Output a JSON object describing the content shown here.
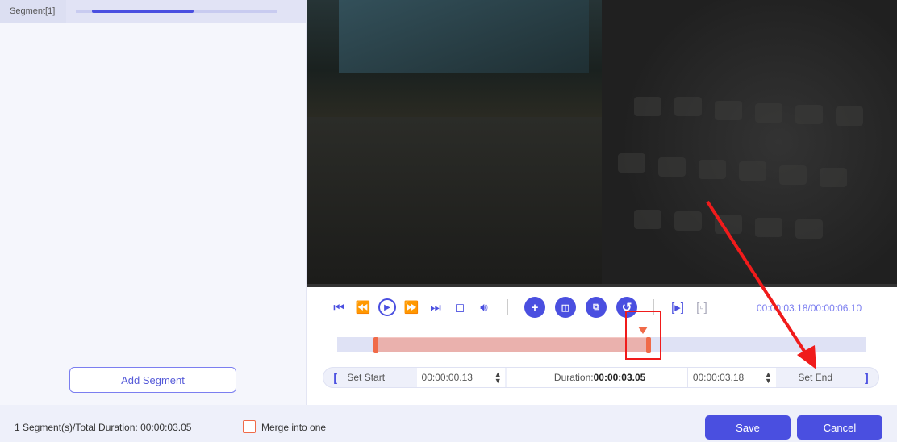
{
  "left_panel": {
    "segment_label": "Segment[1]",
    "segment_progress": 0.5,
    "add_segment": "Add Segment"
  },
  "controls": {
    "icons": [
      "skip-start-icon",
      "step-back-icon",
      "play-icon",
      "step-forward-icon",
      "skip-end-icon",
      "stop-icon",
      "volume-icon"
    ],
    "actions": [
      "add-icon",
      "split-icon",
      "copy-icon",
      "reset-icon"
    ],
    "preview_icons": [
      "preview-play-icon",
      "preview-stop-icon"
    ],
    "current_time": "00:00:03.18",
    "total_time": "00:00:06.10"
  },
  "timeline": {
    "start_fraction": 0.021,
    "end_fraction": 0.521,
    "playhead_fraction": 0.521
  },
  "trim": {
    "open_bracket": "[",
    "set_start": "Set Start",
    "start_time": "00:00:00.13",
    "duration_label": "Duration:",
    "duration": "00:00:03.05",
    "end_time": "00:00:03.18",
    "set_end": "Set End",
    "close_bracket": "]"
  },
  "footer": {
    "summary": "1 Segment(s)/Total Duration: 00:00:03.05",
    "merge_label": "Merge into one",
    "merge_checked": false,
    "save": "Save",
    "cancel": "Cancel"
  },
  "colors": {
    "accent": "#4a4fe0",
    "handle": "#f06a48",
    "annotation": "#f01b1b"
  }
}
